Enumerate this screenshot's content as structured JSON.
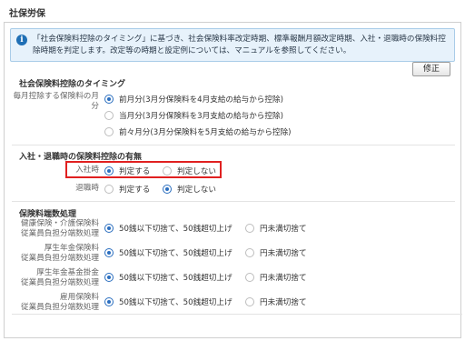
{
  "page_title": "社保労保",
  "info": {
    "icon": "info-icon",
    "text": "「社会保険料控除のタイミング」に基づき、社会保険料率改定時期、標準報酬月額改定時期、入社・退職時の保険料控除時期を判定します。改定等の時期と設定例については、マニュアルを参照してください。"
  },
  "edit_button": "修正",
  "timing": {
    "title": "社会保険料控除のタイミング",
    "label": "毎月控除する保険料の月分",
    "options": [
      "前月分(3月分保険料を4月支給の給与から控除)",
      "当月分(3月分保険料を3月支給の給与から控除)",
      "前々月分(3月分保険料を5月支給の給与から控除)"
    ],
    "selected_index": 0
  },
  "join_leave": {
    "title": "入社・退職時の保険料控除の有無",
    "rows": [
      {
        "label": "入社時",
        "options": [
          "判定する",
          "判定しない"
        ],
        "selected_index": 0
      },
      {
        "label": "退職時",
        "options": [
          "判定する",
          "判定しない"
        ],
        "selected_index": 1
      }
    ]
  },
  "rounding": {
    "title": "保険料端数処理",
    "options": [
      "50銭以下切捨て、50銭超切上げ",
      "円未満切捨て"
    ],
    "rows": [
      {
        "label_line1": "健康保険・介護保険料",
        "label_line2": "従業員負担分端数処理",
        "selected_index": 0
      },
      {
        "label_line1": "厚生年金保険料",
        "label_line2": "従業員負担分端数処理",
        "selected_index": 0
      },
      {
        "label_line1": "厚生年金基金掛金",
        "label_line2": "従業員負担分端数処理",
        "selected_index": 0
      },
      {
        "label_line1": "雇用保険料",
        "label_line2": "従業員負担分端数処理",
        "selected_index": 0
      }
    ]
  },
  "colors": {
    "accent": "#2a6ebf",
    "info_bg": "#e7f2fb",
    "highlight": "#e02020"
  }
}
